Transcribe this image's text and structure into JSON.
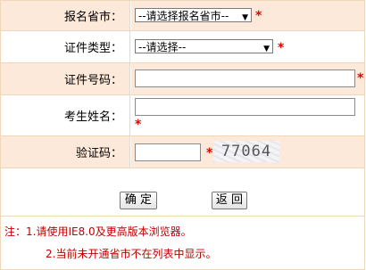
{
  "form": {
    "province": {
      "label": "报名省市：",
      "selected": "--请选择报名省市--"
    },
    "cert_type": {
      "label": "证件类型：",
      "selected": "--请选择--"
    },
    "cert_number": {
      "label": "证件号码：",
      "value": ""
    },
    "name": {
      "label": "考生姓名：",
      "value": ""
    },
    "captcha": {
      "label": "验证码：",
      "value": "",
      "image_text": "77064"
    },
    "required_mark": "*",
    "arrow_glyph": "▼"
  },
  "buttons": {
    "confirm": "确 定",
    "back": "返 回"
  },
  "notes": {
    "line1": "注：1.请使用IE8.0及更高版本浏览器。",
    "line2": "2.当前未开通省市不在列表中显示。"
  },
  "colors": {
    "row_bg": "#fde9d9",
    "border": "#f0d7b8",
    "required": "#e60000",
    "note": "#c00000"
  }
}
